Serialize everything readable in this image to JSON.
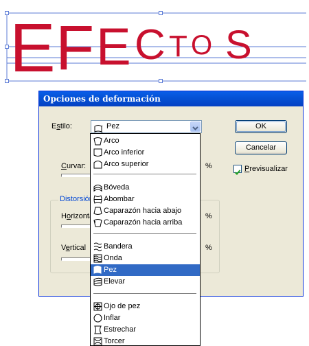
{
  "artwork": {
    "text": "EFECTOS",
    "color": "#c8102e"
  },
  "dialog": {
    "title": "Opciones de deformación",
    "style_label": "Estilo:",
    "style_value": "Pez",
    "ok_label": "OK",
    "cancel_label": "Cancelar",
    "preview_label": "Previsualizar",
    "bend_label": "Curvar:",
    "distortion_label": "Distorsión",
    "horizontal_label": "Horizontal",
    "vertical_label": "Vertical",
    "percent_sign": "%"
  },
  "dropdown": {
    "items": [
      "Arco",
      "Arco inferior",
      "Arco superior",
      "Bóveda",
      "Abombar",
      "Caparazón hacia abajo",
      "Caparazón hacia arriba",
      "Bandera",
      "Onda",
      "Pez",
      "Elevar",
      "Ojo de pez",
      "Inflar",
      "Estrechar",
      "Torcer"
    ],
    "selected": "Pez",
    "icons": [
      "arc-icon",
      "arc-lower-icon",
      "arc-upper-icon",
      "arch-icon",
      "bulge-icon",
      "shell-lower-icon",
      "shell-upper-icon",
      "flag-icon",
      "wave-icon",
      "fish-icon",
      "rise-icon",
      "fisheye-icon",
      "inflate-icon",
      "squeeze-icon",
      "twist-icon"
    ]
  },
  "colors": {
    "title_bar": "#0553d6",
    "selection": "#316ac5",
    "dialog_bg": "#ece9d8"
  }
}
